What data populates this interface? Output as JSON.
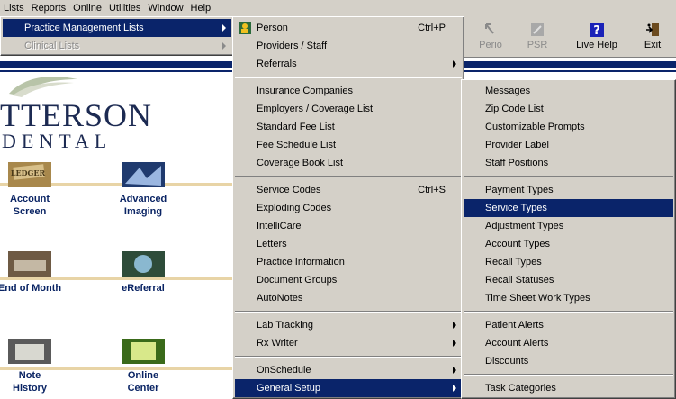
{
  "menubar": {
    "items": [
      "Lists",
      "Reports",
      "Online",
      "Utilities",
      "Window",
      "Help"
    ]
  },
  "toolbar": {
    "perio": "Perio",
    "psr": "PSR",
    "live_help": "Live Help",
    "exit": "Exit"
  },
  "background": {
    "logo_line1": "TTERSON",
    "logo_line2": "DENTAL",
    "tiles": {
      "account_screen": "Account\nScreen",
      "advanced_imaging": "Advanced\nImaging",
      "end_of_month": "End of Month",
      "ereferral": "eReferral",
      "note_history": "Note\nHistory",
      "online_center": "Online\nCenter"
    }
  },
  "lists_menu": {
    "items": [
      "Practice Management Lists",
      "Clinical Lists"
    ]
  },
  "pm_menu": {
    "person": "Person",
    "person_shortcut": "Ctrl+P",
    "providers": "Providers / Staff",
    "referrals": "Referrals",
    "insurance": "Insurance Companies",
    "employers": "Employers / Coverage List",
    "standard_fee": "Standard Fee List",
    "fee_schedule": "Fee Schedule List",
    "coverage_book": "Coverage Book List",
    "service_codes": "Service Codes",
    "service_codes_shortcut": "Ctrl+S",
    "exploding_codes": "Exploding Codes",
    "intellicare": "IntelliCare",
    "letters": "Letters",
    "practice_info": "Practice Information",
    "document_groups": "Document Groups",
    "autonotes": "AutoNotes",
    "lab_tracking": "Lab Tracking",
    "rx_writer": "Rx Writer",
    "onschedule": "OnSchedule",
    "general_setup": "General Setup"
  },
  "gs_menu": {
    "messages": "Messages",
    "zip_code": "Zip Code List",
    "custom_prompts": "Customizable Prompts",
    "provider_label": "Provider Label",
    "staff_positions": "Staff Positions",
    "payment_types": "Payment Types",
    "service_types": "Service Types",
    "adjustment_types": "Adjustment Types",
    "account_types": "Account Types",
    "recall_types": "Recall Types",
    "recall_statuses": "Recall Statuses",
    "time_sheet": "Time Sheet Work Types",
    "patient_alerts": "Patient Alerts",
    "account_alerts": "Account Alerts",
    "discounts": "Discounts",
    "task_categories": "Task Categories"
  },
  "colors": {
    "highlight": "#0a246a",
    "menu_face": "#d4d0c8",
    "brand_navy": "#1c2a52"
  }
}
